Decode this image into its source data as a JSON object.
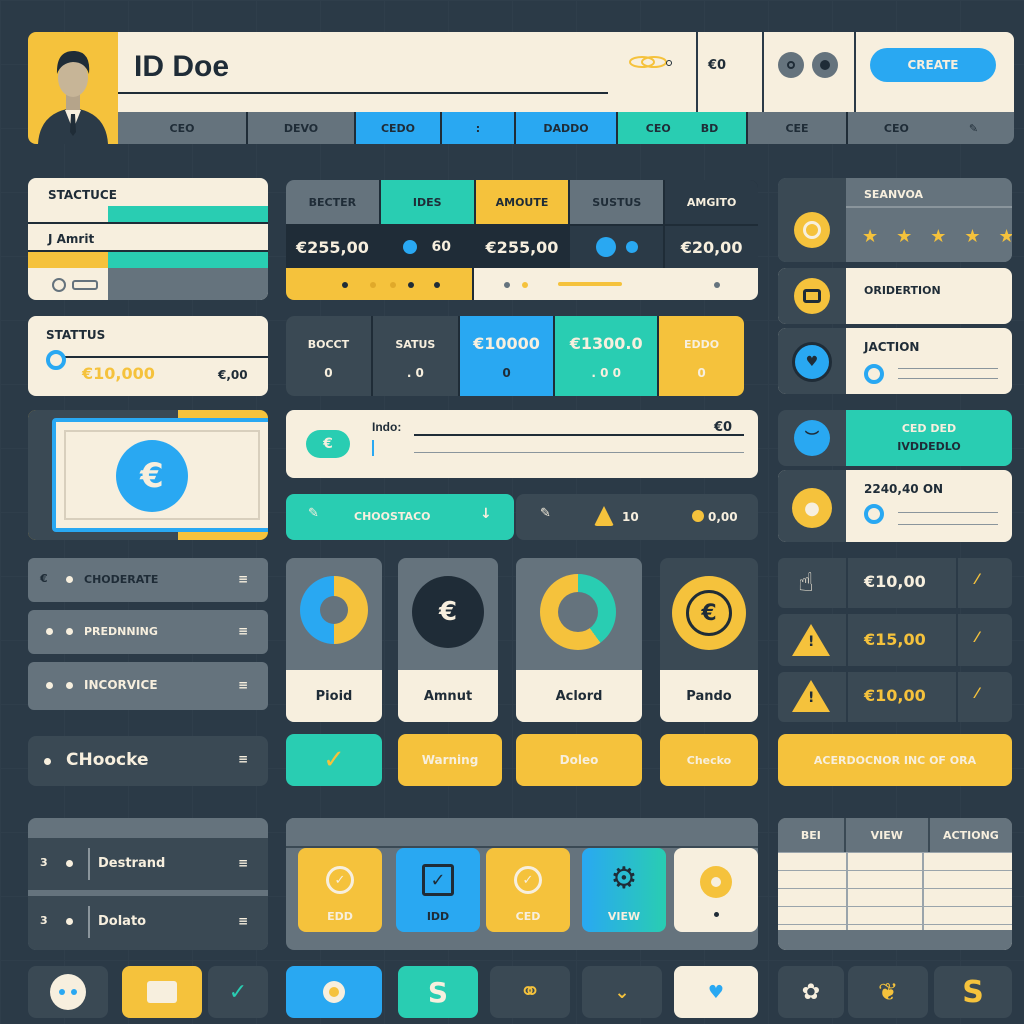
{
  "header": {
    "title": "ID Doe",
    "amount": "€0",
    "create_label": "CREATE",
    "tabs": [
      "CEO",
      "DEVO",
      "CEDO",
      ":",
      "DADDO",
      "CEO",
      "BD",
      "CEE",
      "CEO"
    ]
  },
  "left": {
    "card1": {
      "title": "STACTUCE",
      "label2": "J Amrit"
    },
    "card2": {
      "title": "STATTUS",
      "amount": "€10,000",
      "amount2": "€,00"
    },
    "menu": [
      "CHODERATE",
      "PREDNNING",
      "INCORVICE"
    ],
    "checkout": "CHoocke",
    "list2": [
      {
        "num": "3",
        "label": "Destrand"
      },
      {
        "num": "3",
        "label": "Dolato"
      }
    ]
  },
  "center": {
    "table": {
      "headers": [
        "BECTER",
        "IDES",
        "AMOUTE",
        "SUSTUS",
        "AMGITO"
      ],
      "values": [
        "€255,00",
        "60",
        "€255,00",
        "",
        "€20,00"
      ]
    },
    "status_row": {
      "labels": [
        "BOCCT",
        "SATUS"
      ],
      "blue": "€10000",
      "teal": "€1300.0",
      "yellow": "EDDO",
      "subvals": [
        "0",
        ". 0",
        "0",
        ". 0 0",
        "0"
      ]
    },
    "input": {
      "label": "Indo:",
      "value": "€0"
    },
    "choose_label": "CHOOSTACO",
    "bar2": {
      "count": "10",
      "amount": "0,00"
    },
    "tiles": [
      "Pioid",
      "Amnut",
      "Aclord",
      "Pando"
    ],
    "buttons": [
      "Warning",
      "Doleo",
      "Checko"
    ],
    "squares": [
      "EDD",
      "IDD",
      "CED",
      "VIEW"
    ]
  },
  "right": {
    "rating": {
      "label": "SEANVOA"
    },
    "item1": "ORIDERTION",
    "item2": "JACTION",
    "item3": {
      "line1": "CED DED",
      "line2": "IVDDEDLO"
    },
    "item4": "2240,40 ON",
    "rows": [
      "€10,00",
      "€15,00",
      "€10,00"
    ],
    "banner": "ACERDOCNOR INC OF ORA",
    "table": {
      "headers": [
        "BEI",
        "VIEW",
        "ACTIONG"
      ]
    }
  },
  "bottom": {
    "icons": [
      "chat-icon",
      "mail-icon",
      "check-icon",
      "record-icon",
      "s-icon",
      "link-icon",
      "down-icon",
      "heart-icon",
      "gear-icon",
      "leaf-icon",
      "dollar-icon"
    ]
  }
}
